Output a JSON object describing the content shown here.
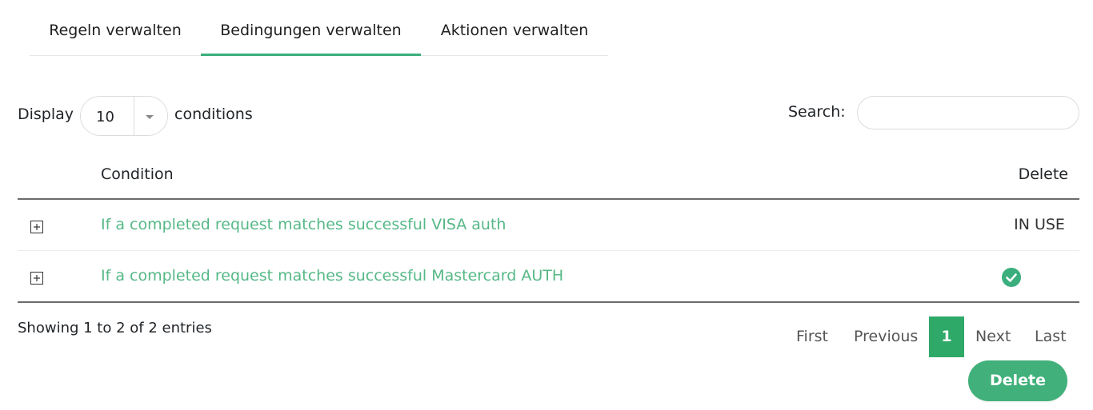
{
  "tabs": [
    {
      "label": "Regeln verwalten",
      "active": false
    },
    {
      "label": "Bedingungen verwalten",
      "active": true
    },
    {
      "label": "Aktionen verwalten",
      "active": false
    }
  ],
  "length_control": {
    "prefix": "Display",
    "value": "10",
    "suffix": "conditions"
  },
  "search": {
    "label": "Search:",
    "value": "",
    "placeholder": ""
  },
  "table": {
    "headers": {
      "condition": "Condition",
      "delete": "Delete"
    },
    "rows": [
      {
        "condition": "If a completed request matches successful VISA auth",
        "delete_status": "IN USE"
      },
      {
        "condition": "If a completed request matches successful Mastercard AUTH",
        "delete_status": "check-circle-icon"
      }
    ]
  },
  "info": "Showing 1 to 2 of 2 entries",
  "pagination": {
    "first": "First",
    "previous": "Previous",
    "current": "1",
    "next": "Next",
    "last": "Last"
  },
  "delete_button": "Delete",
  "colors": {
    "accent": "#3aae7d",
    "link": "#56b886",
    "pager_active": "#2fa968",
    "button": "#41b07a"
  }
}
